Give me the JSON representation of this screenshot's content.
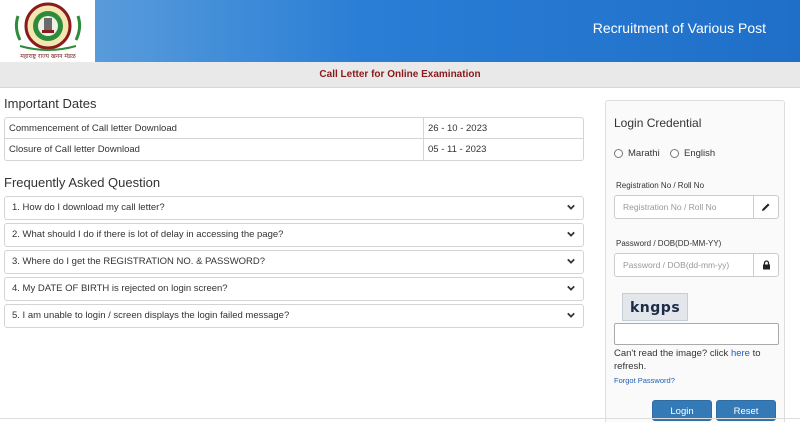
{
  "header": {
    "title": "Recruitment of Various Post",
    "logo_caption": "महाराष्ट्र राज्य खनन मंडळ",
    "subtitle": "Call Letter for Online Examination"
  },
  "important_dates": {
    "title": "Important Dates",
    "rows": [
      {
        "label": "Commencement of Call letter Download",
        "value": "26 - 10 - 2023"
      },
      {
        "label": "Closure of Call letter Download",
        "value": "05 - 11 - 2023"
      }
    ]
  },
  "faq": {
    "title": "Frequently Asked Question",
    "items": [
      "1. How do I download my call letter?",
      "2. What should I do if there is lot of delay in accessing the page?",
      "3. Where do I get the REGISTRATION NO. & PASSWORD?",
      "4. My DATE OF BIRTH is rejected on login screen?",
      "5. I am unable to login / screen displays the login failed message?"
    ]
  },
  "login": {
    "title": "Login Credential",
    "lang_marathi": "Marathi",
    "lang_english": "English",
    "reg_label": "Registration No / Roll No",
    "reg_placeholder": "Registration No / Roll No",
    "pwd_label": "Password / DOB(DD-MM-YY)",
    "pwd_placeholder": "Password / DOB(dd-mm-yy)",
    "captcha_text": "kngps",
    "cant_read_prefix": "Can't read the image? click ",
    "here": "here",
    "cant_read_suffix": " to refresh.",
    "forgot": "Forgot Password?",
    "login_btn": "Login",
    "reset_btn": "Reset"
  }
}
